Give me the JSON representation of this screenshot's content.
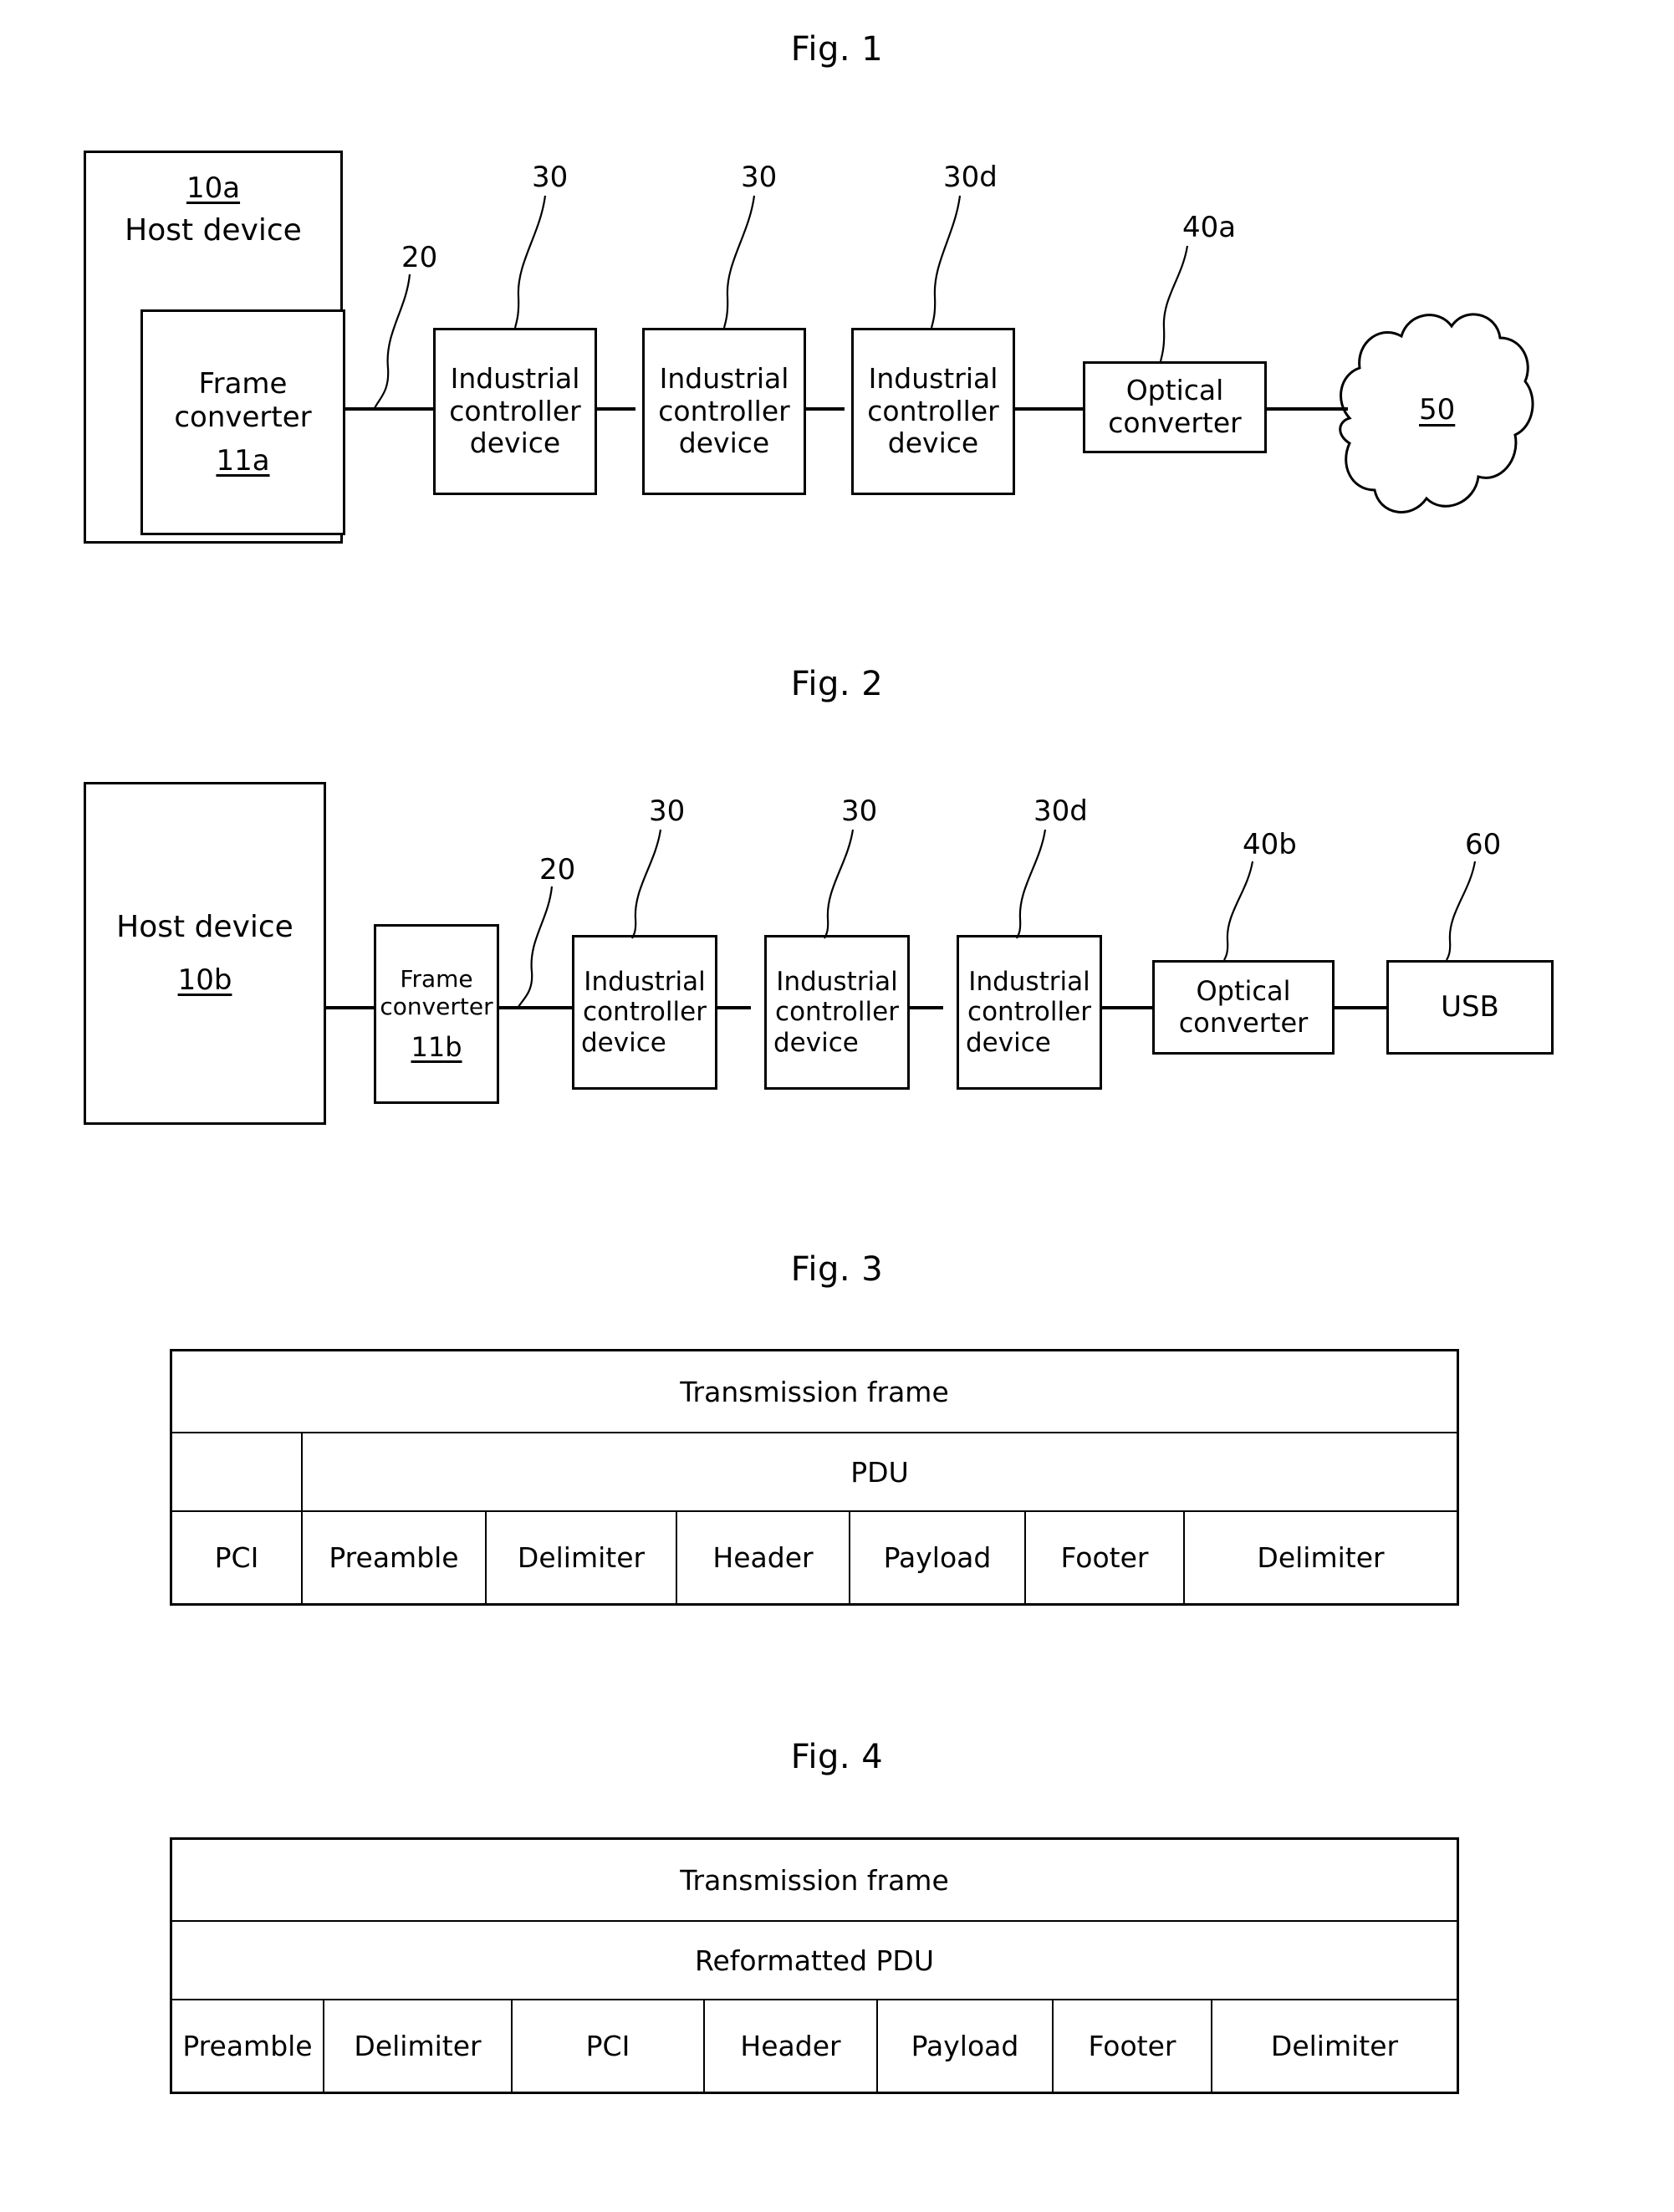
{
  "figures": {
    "fig1": {
      "title": "Fig. 1",
      "host": {
        "ref": "10a",
        "label": "Host device"
      },
      "frame_converter": {
        "line1": "Frame",
        "line2": "converter",
        "ref": "11a"
      },
      "bus_ref": "20",
      "controllers": [
        {
          "line1": "Industrial",
          "line2": "controller",
          "line3": "device",
          "ref": "30"
        },
        {
          "line1": "Industrial",
          "line2": "controller",
          "line3": "device",
          "ref": "30"
        },
        {
          "line1": "Industrial",
          "line2": "controller",
          "line3": "device",
          "ref": "30d"
        }
      ],
      "optical": {
        "line1": "Optical",
        "line2": "converter",
        "ref": "40a"
      },
      "cloud": {
        "ref": "50"
      }
    },
    "fig2": {
      "title": "Fig. 2",
      "host": {
        "label": "Host device",
        "ref": "10b"
      },
      "frame_converter": {
        "line1": "Frame",
        "line2": "converter",
        "ref": "11b"
      },
      "bus_ref": "20",
      "controllers": [
        {
          "line1": "Industrial",
          "line2": "controller",
          "line3": "device",
          "ref": "30"
        },
        {
          "line1": "Industrial",
          "line2": "controller",
          "line3": "device",
          "ref": "30"
        },
        {
          "line1": "Industrial",
          "line2": "controller",
          "line3": "device",
          "ref": "30d"
        }
      ],
      "optical": {
        "line1": "Optical",
        "line2": "converter",
        "ref": "40b"
      },
      "usb": {
        "label": "USB",
        "ref": "60"
      }
    },
    "fig3": {
      "title": "Fig. 3",
      "row1_label": "Transmission frame",
      "row2_label": "PDU",
      "fields": [
        "PCI",
        "Preamble",
        "Delimiter",
        "Header",
        "Payload",
        "Footer",
        "Delimiter"
      ]
    },
    "fig4": {
      "title": "Fig. 4",
      "row1_label": "Transmission frame",
      "row2_label": "Reformatted PDU",
      "fields": [
        "Preamble",
        "Delimiter",
        "PCI",
        "Header",
        "Payload",
        "Footer",
        "Delimiter"
      ]
    }
  },
  "colors": {
    "ink": "#000000",
    "paper": "#ffffff"
  }
}
